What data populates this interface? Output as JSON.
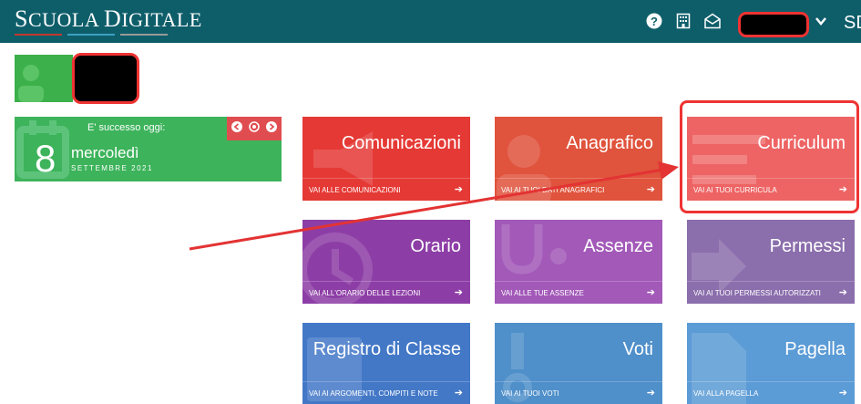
{
  "header": {
    "logo_first": "S",
    "logo_rest1": "CUOLA ",
    "logo_second": "D",
    "logo_rest2": "IGITALE",
    "sd_text": "SD"
  },
  "today": {
    "title": "E' successo oggi:",
    "day": "8",
    "weekday": "mercoledì",
    "month_year": "SETTEMBRE 2021"
  },
  "tiles": [
    {
      "title": "Comunicazioni",
      "link": "VAI ALLE COMUNICAZIONI",
      "color": "#e53935",
      "icon": "megaphone-icon"
    },
    {
      "title": "Anagrafico",
      "link": "VAI AI TUOI DATI ANAGRAFICI",
      "color": "#e0533c",
      "icon": "person-icon"
    },
    {
      "title": "Curriculum",
      "link": "VAI AI TUOI CURRICULA",
      "color": "#ee6464",
      "icon": "document-icon"
    },
    {
      "title": "Orario",
      "link": "VAI ALL'ORARIO DELLE LEZIONI",
      "color": "#8d3ea6",
      "icon": "clock-icon"
    },
    {
      "title": "Assenze",
      "link": "VAI ALLE TUE ASSENZE",
      "color": "#a259b8",
      "icon": "stethoscope-icon"
    },
    {
      "title": "Permessi",
      "link": "VAI AI TUOI PERMESSI AUTORIZZATI",
      "color": "#8b6eac",
      "icon": "exit-icon"
    },
    {
      "title": "Registro di Classe",
      "link": "VAI AI ARGOMENTI, COMPITI E NOTE",
      "color": "#4378c7",
      "icon": "register-icon"
    },
    {
      "title": "Voti",
      "link": "VAI AI TUOI VOTI",
      "color": "#4f8fca",
      "icon": "grades-icon"
    },
    {
      "title": "Pagella",
      "link": "VAI ALLA PAGELLA",
      "color": "#5b9bd6",
      "icon": "report-icon"
    }
  ],
  "colors": {
    "header": "#0e5e6a",
    "annotation": "#e33333"
  }
}
